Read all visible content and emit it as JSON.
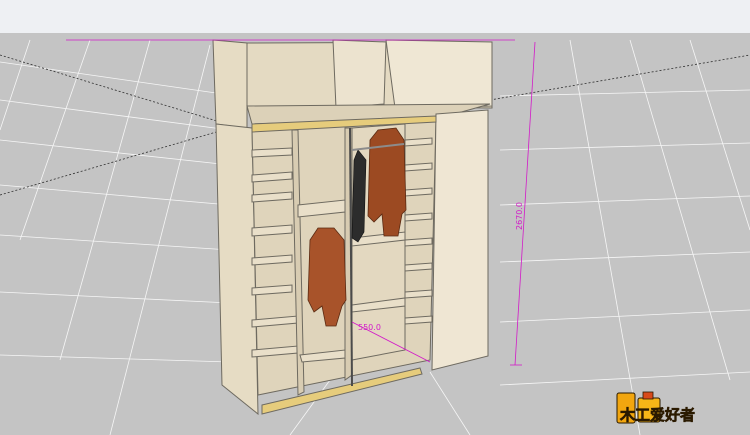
{
  "viewport": {
    "sky_color": "#eef0f3",
    "ground_color": "#c4c4c4",
    "grid_color": "#ffffff",
    "axis_color": "#2f2f2f"
  },
  "model": {
    "panel_color": "#e9dfc9",
    "panel_shade": "#d8ccb2",
    "edge_color": "#6e6a60",
    "rail_color": "#e6cc7c"
  },
  "dimensions": {
    "height_label": "2670.0",
    "depth_label": "550.0",
    "dim_color": "#d21bc8"
  },
  "watermark": {
    "text": "木工爱好者",
    "logo_icon": "woodworker-logo-icon"
  }
}
